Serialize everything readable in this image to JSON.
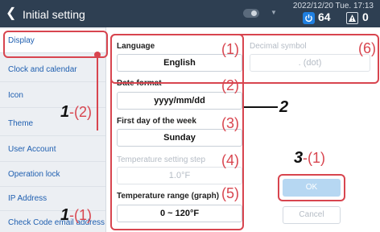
{
  "header": {
    "back_icon": "chevron-left-icon",
    "title": "Initial setting",
    "datetime": "2022/12/20 Tue. 17:13",
    "power_count": "64",
    "alert_count": "0"
  },
  "sidebar": {
    "items": [
      {
        "label": "Display",
        "active": true
      },
      {
        "label": "Clock and calendar"
      },
      {
        "label": "Icon"
      },
      {
        "label": "Theme"
      },
      {
        "label": "User Account"
      },
      {
        "label": "Operation lock"
      },
      {
        "label": "IP Address"
      },
      {
        "label": "Check Code email address"
      }
    ]
  },
  "settings": {
    "language": {
      "label": "Language",
      "value": "English"
    },
    "decimal": {
      "label": "Decimal symbol",
      "value": ". (dot)"
    },
    "date_format": {
      "label": "Date format",
      "value": "yyyy/mm/dd"
    },
    "first_day": {
      "label": "First day of the week",
      "value": "Sunday"
    },
    "temp_step": {
      "label": "Temperature setting step",
      "value": "1.0°F"
    },
    "temp_range": {
      "label": "Temperature range (graph)",
      "value": "0 ~ 120°F"
    }
  },
  "buttons": {
    "ok": "OK",
    "cancel": "Cancel"
  },
  "annotations": {
    "n1": "(1)",
    "n2": "(2)",
    "n3": "(3)",
    "n4": "(4)",
    "n5": "(5)",
    "n6": "(6)",
    "left_top_big": "1",
    "left_top_sub": "-(2)",
    "left_bottom_big": "1",
    "left_bottom_sub": "-(1)",
    "right_big": "2",
    "ok_big": "3",
    "ok_sub": "-(1)"
  },
  "colors": {
    "header_bg": "#2e3f52",
    "annotation_red": "#d8454f",
    "link_blue": "#1f5fb0"
  }
}
